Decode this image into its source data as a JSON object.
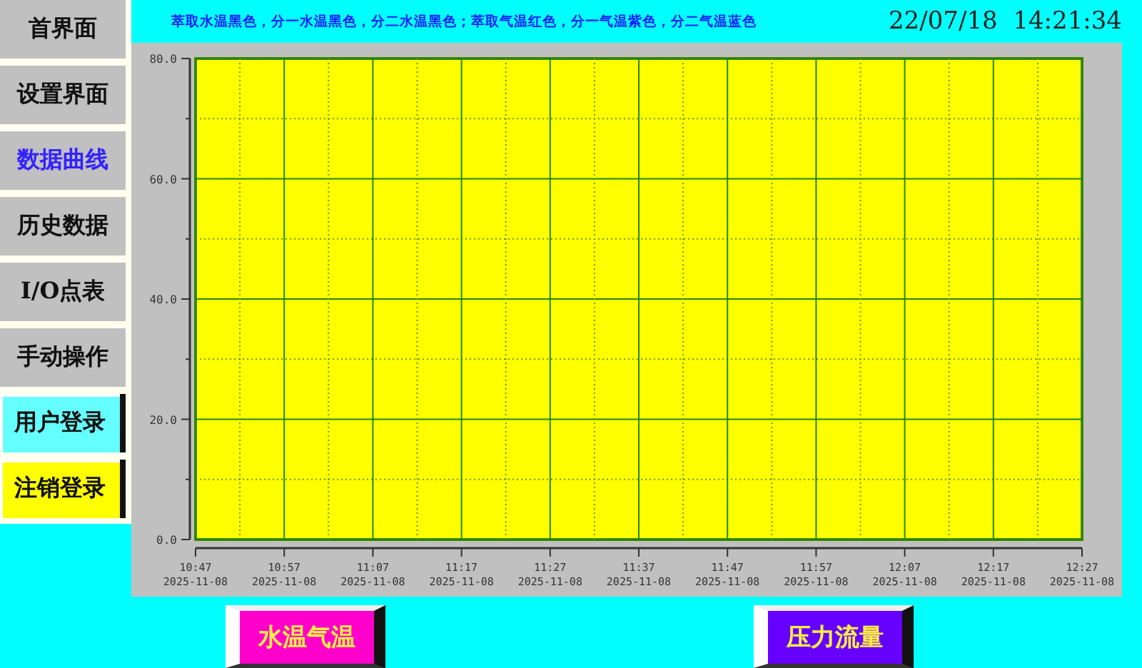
{
  "sidebar": {
    "items": [
      {
        "label": "首界面",
        "selected": false,
        "kind": "plain"
      },
      {
        "label": "设置界面",
        "selected": false,
        "kind": "plain"
      },
      {
        "label": "数据曲线",
        "selected": true,
        "kind": "plain"
      },
      {
        "label": "历史数据",
        "selected": false,
        "kind": "plain"
      },
      {
        "label": "I/O点表",
        "selected": false,
        "kind": "plain"
      },
      {
        "label": "手动操作",
        "selected": false,
        "kind": "plain"
      },
      {
        "label": "用户登录",
        "selected": false,
        "kind": "raised",
        "color": "#66ffff"
      },
      {
        "label": "注销登录",
        "selected": false,
        "kind": "raised",
        "color": "#ffff00"
      }
    ]
  },
  "header": {
    "legend": "萃取水温黑色，分一水温黑色，分二水温黑色；萃取气温红色，分一气温紫色，分二气温蓝色",
    "datetime": "22/07/18  14:21:34"
  },
  "chart": {
    "chart_data": {
      "type": "line",
      "grid": true,
      "categories": [
        "10:47\n2025-11-08",
        "10:57\n2025-11-08",
        "11:07\n2025-11-08",
        "11:17\n2025-11-08",
        "11:27\n2025-11-08",
        "11:37\n2025-11-08",
        "11:47\n2025-11-08",
        "11:57\n2025-11-08",
        "12:07\n2025-11-08",
        "12:17\n2025-11-08",
        "12:27\n2025-11-08"
      ],
      "ylim": [
        0,
        80
      ],
      "yticks": [
        {
          "value": 0,
          "label": "0.0"
        },
        {
          "value": 20,
          "label": "20.0"
        },
        {
          "value": 40,
          "label": "40.0"
        },
        {
          "value": 60,
          "label": "60.0"
        },
        {
          "value": 80,
          "label": "80.0"
        }
      ]
    }
  },
  "buttons": [
    {
      "label": "水温气温",
      "color": "#ff00cc"
    },
    {
      "label": "压力流量",
      "color": "#6600ff"
    }
  ]
}
